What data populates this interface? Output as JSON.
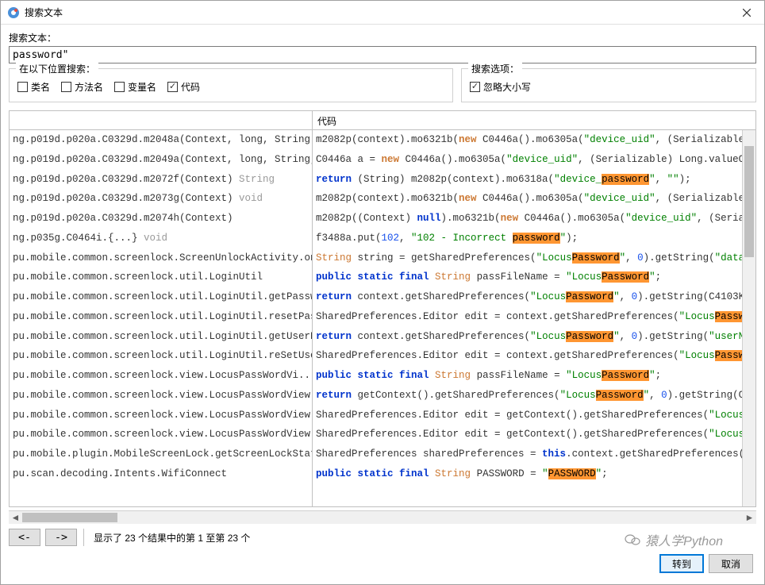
{
  "titlebar": {
    "title": "搜索文本"
  },
  "search": {
    "label": "搜索文本：",
    "value": "password\""
  },
  "locations": {
    "legend": "在以下位置搜索：",
    "class": "类名",
    "method": "方法名",
    "var": "变量名",
    "code": "代码"
  },
  "options": {
    "legend": "搜索选项：",
    "ignorecase": "忽略大小写"
  },
  "col_code": "代码",
  "left_items": [
    {
      "t": "ng.p019d.p020a.C0329d.m2048a(Context, long, String)",
      "r": ""
    },
    {
      "t": "ng.p019d.p020a.C0329d.m2049a(Context, long, String,",
      "r": ""
    },
    {
      "t": "ng.p019d.p020a.C0329d.m2072f(Context)",
      "r": "String"
    },
    {
      "t": "ng.p019d.p020a.C0329d.m2073g(Context)",
      "r": "void"
    },
    {
      "t": "ng.p019d.p020a.C0329d.m2074h(Context)",
      "r": ""
    },
    {
      "t": "ng.p035g.C0464i.{...}",
      "r": "void"
    },
    {
      "t": "pu.mobile.common.screenlock.ScreenUnlockActivity.on",
      "r": ""
    },
    {
      "t": "pu.mobile.common.screenlock.util.LoginUtil",
      "r": ""
    },
    {
      "t": "pu.mobile.common.screenlock.util.LoginUtil.getPassw",
      "r": ""
    },
    {
      "t": "pu.mobile.common.screenlock.util.LoginUtil.resetPass",
      "r": ""
    },
    {
      "t": "pu.mobile.common.screenlock.util.LoginUtil.getUserN",
      "r": ""
    },
    {
      "t": "pu.mobile.common.screenlock.util.LoginUtil.reSetUse",
      "r": ""
    },
    {
      "t": "pu.mobile.common.screenlock.view.LocusPassWordVi...",
      "r": ""
    },
    {
      "t": "pu.mobile.common.screenlock.view.LocusPassWordView.",
      "r": ""
    },
    {
      "t": "pu.mobile.common.screenlock.view.LocusPassWordView.",
      "r": ""
    },
    {
      "t": "pu.mobile.common.screenlock.view.LocusPassWordView.",
      "r": ""
    },
    {
      "t": "pu.mobile.plugin.MobileScreenLock.getScreenLockStat",
      "r": ""
    },
    {
      "t": "pu.scan.decoding.Intents.WifiConnect",
      "r": ""
    }
  ],
  "nav": {
    "back": "<-",
    "fwd": "->",
    "status": "显示了 23 个结果中的第 1 至第 23 个"
  },
  "buttons": {
    "go": "转到",
    "cancel": "取消"
  },
  "watermark": "猿人学Python"
}
